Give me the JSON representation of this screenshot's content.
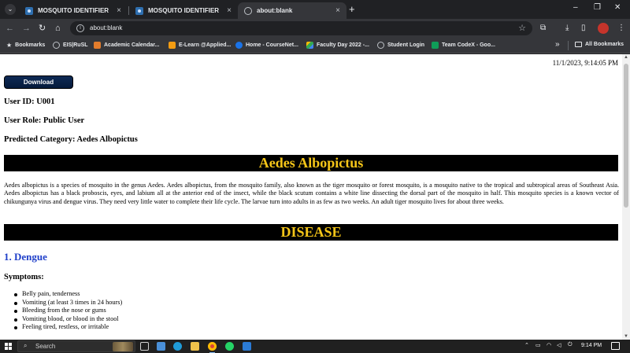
{
  "browser": {
    "tabs": [
      {
        "title": "MOSQUITO IDENTIFIER",
        "active": false
      },
      {
        "title": "MOSQUITO IDENTIFIER",
        "active": false
      },
      {
        "title": "about:blank",
        "active": true
      }
    ],
    "address": "about:blank",
    "bookmarks": [
      {
        "label": "Bookmarks",
        "icon": "star-icon",
        "color": "#e8eaed"
      },
      {
        "label": "EIS|RuSL",
        "icon": "globe-icon",
        "color": "#bdc1c6"
      },
      {
        "label": "Academic Calendar...",
        "icon": "calendar-icon",
        "color": "#e37c2c"
      },
      {
        "label": "E-Learn @Applied...",
        "icon": "elearn-icon",
        "color": "#f39c12"
      },
      {
        "label": "Home - CourseNet...",
        "icon": "coursenet-icon",
        "color": "#1a73e8"
      },
      {
        "label": "Faculty Day 2022 -...",
        "icon": "drive-icon",
        "color": "#fbbc04"
      },
      {
        "label": "Student Login",
        "icon": "globe-icon",
        "color": "#bdc1c6"
      },
      {
        "label": "Team CodeX - Goo...",
        "icon": "sheets-icon",
        "color": "#0f9d58"
      }
    ],
    "all_bookmarks": "All Bookmarks"
  },
  "page": {
    "timestamp": "11/1/2023, 9:14:05 PM",
    "download_label": "Download",
    "user_id": "User ID: U001",
    "user_role": "User Role: Public User",
    "predicted_category": "Predicted Category: Aedes Albopictus",
    "species_title": "Aedes Albopictus",
    "description": "Aedes albopictus is a species of mosquito in the genus Aedes. Aedes albopictus, from the mosquito family, also known as the tiger mosquito or forest mosquito, is a mosquito native to the tropical and subtropical areas of Southeast Asia. Aedes albopictus has a black proboscis, eyes, and labium all at the anterior end of the insect, while the black scutum contains a white line dissecting the dorsal part of the mosquito in half. This mosquito species is a known vector of chikungunya virus and dengue virus. They need very little water to complete their life cycle. The larvae turn into adults in as few as two weeks. An adult tiger mosquito lives for about three weeks.",
    "disease_title": "DISEASE",
    "disease_name": "1. Dengue",
    "symptoms_heading": "Symptoms:",
    "symptoms": [
      "Belly pain, tenderness",
      "Vomiting (at least 3 times in 24 hours)",
      "Bleeding from the nose or gums",
      "Vomiting blood, or blood in the stool",
      "Feeling tired, restless, or irritable"
    ],
    "colors": {
      "banner_bg": "#000000",
      "banner_text": "#f5c518",
      "disease_link": "#1f3fc9"
    }
  },
  "taskbar": {
    "search_label": "Search",
    "time": "9:14 PM"
  }
}
